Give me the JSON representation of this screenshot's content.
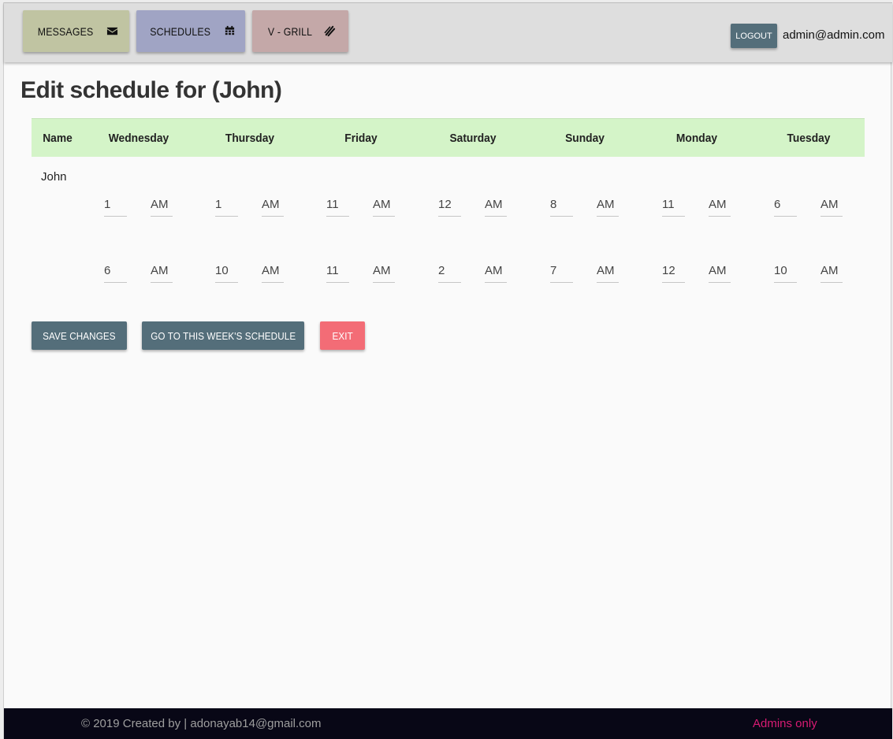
{
  "nav": {
    "messages_label": "MESSAGES",
    "schedules_label": "SCHEDULES",
    "grill_label": "V - GRILL",
    "logout_label": "LOGOUT",
    "user_email": "admin@admin.com",
    "colors": {
      "messages": "#c0c4a2",
      "schedules": "#a0a4c4",
      "grill": "#c4a8a8",
      "logout": "#546e7a"
    },
    "icons": {
      "messages": "envelope-icon",
      "schedules": "calendar-icon",
      "grill": "grill-icon"
    }
  },
  "page": {
    "title": "Edit schedule for (John)"
  },
  "table": {
    "header_color": "#d4f4c8",
    "columns": [
      "Name",
      "Wednesday",
      "Thursday",
      "Friday",
      "Saturday",
      "Sunday",
      "Monday",
      "Tuesday"
    ],
    "employee": "John",
    "rows": [
      [
        {
          "hour": "1",
          "period": "AM"
        },
        {
          "hour": "1",
          "period": "AM"
        },
        {
          "hour": "11",
          "period": "AM"
        },
        {
          "hour": "12",
          "period": "AM"
        },
        {
          "hour": "8",
          "period": "AM"
        },
        {
          "hour": "11",
          "period": "AM"
        },
        {
          "hour": "6",
          "period": "AM"
        }
      ],
      [
        {
          "hour": "6",
          "period": "AM"
        },
        {
          "hour": "10",
          "period": "AM"
        },
        {
          "hour": "11",
          "period": "AM"
        },
        {
          "hour": "2",
          "period": "AM"
        },
        {
          "hour": "7",
          "period": "AM"
        },
        {
          "hour": "12",
          "period": "AM"
        },
        {
          "hour": "10",
          "period": "AM"
        }
      ]
    ]
  },
  "actions": {
    "save_label": "SAVE CHANGES",
    "goto_label": "GO TO THIS WEEK'S SCHEDULE",
    "exit_label": "EXIT",
    "colors": {
      "save": "#546e7a",
      "goto": "#546e7a",
      "exit": "#f36c76"
    }
  },
  "footer": {
    "copyright": "© 2019 Created by | adonayab14@gmail.com",
    "admins_only": "Admins only",
    "admins_color": "#d81b73"
  }
}
